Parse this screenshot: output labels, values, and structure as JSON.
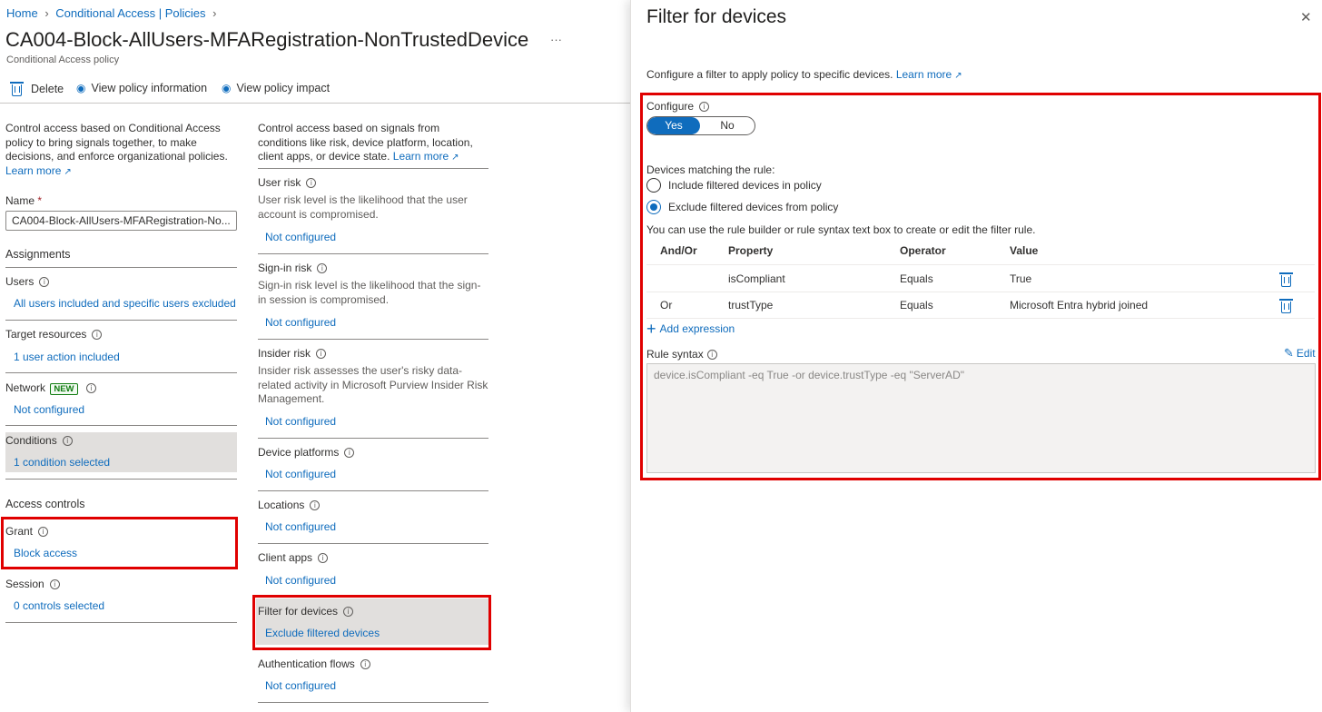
{
  "breadcrumb": {
    "home": "Home",
    "separator": ">",
    "policies": "Conditional Access | Policies"
  },
  "page": {
    "title": "CA004-Block-AllUsers-MFARegistration-NonTrustedDevice",
    "more": "···",
    "subtitle": "Conditional Access policy"
  },
  "toolbar": {
    "delete": "Delete",
    "view_info": "View policy information",
    "view_impact": "View policy impact"
  },
  "left": {
    "intro": "Control access based on Conditional Access policy to bring signals together, to make decisions, and enforce organizational policies.",
    "learn_more": "Learn more",
    "name_label": "Name",
    "required": "*",
    "name_value": "CA004-Block-AllUsers-MFARegistration-No...",
    "assignments": "Assignments",
    "users_label": "Users",
    "users_value": "All users included and specific users excluded",
    "target_label": "Target resources",
    "target_value": "1 user action included",
    "network_label": "Network",
    "network_badge": "NEW",
    "network_value": "Not configured",
    "conditions_label": "Conditions",
    "conditions_value": "1 condition selected",
    "access_controls": "Access controls",
    "grant_label": "Grant",
    "grant_value": "Block access",
    "session_label": "Session",
    "session_value": "0 controls selected"
  },
  "middle": {
    "intro": "Control access based on signals from conditions like risk, device platform, location, client apps, or device state.",
    "learn_more": "Learn more",
    "user_risk": {
      "label": "User risk",
      "desc": "User risk level is the likelihood that the user account is compromised.",
      "value": "Not configured"
    },
    "signin_risk": {
      "label": "Sign-in risk",
      "desc": "Sign-in risk level is the likelihood that the sign-in session is compromised.",
      "value": "Not configured"
    },
    "insider_risk": {
      "label": "Insider risk",
      "desc": "Insider risk assesses the user's risky data-related activity in Microsoft Purview Insider Risk Management.",
      "value": "Not configured"
    },
    "device_platforms": {
      "label": "Device platforms",
      "value": "Not configured"
    },
    "locations": {
      "label": "Locations",
      "value": "Not configured"
    },
    "client_apps": {
      "label": "Client apps",
      "value": "Not configured"
    },
    "filter_devices": {
      "label": "Filter for devices",
      "value": "Exclude filtered devices"
    },
    "auth_flows": {
      "label": "Authentication flows",
      "value": "Not configured"
    }
  },
  "panel": {
    "title": "Filter for devices",
    "close": "✕",
    "description": "Configure a filter to apply policy to specific devices.",
    "learn_more": "Learn more",
    "configure_label": "Configure",
    "toggle_yes": "Yes",
    "toggle_no": "No",
    "matching_label": "Devices matching the rule:",
    "include_option": "Include filtered devices in policy",
    "exclude_option": "Exclude filtered devices from policy",
    "builder_hint": "You can use the rule builder or rule syntax text box to create or edit the filter rule.",
    "table_headers": {
      "andor": "And/Or",
      "property": "Property",
      "operator": "Operator",
      "value": "Value"
    },
    "rows": [
      {
        "andor": "",
        "property": "isCompliant",
        "operator": "Equals",
        "value": "True"
      },
      {
        "andor": "Or",
        "property": "trustType",
        "operator": "Equals",
        "value": "Microsoft Entra hybrid joined"
      }
    ],
    "add_expression": "Add expression",
    "rule_syntax_label": "Rule syntax",
    "edit": "Edit",
    "rule_syntax_value": "device.isCompliant -eq True -or device.trustType -eq \"ServerAD\""
  },
  "colors": {
    "accent": "#0f6cbd",
    "highlight": "#e00000",
    "selected_bg": "#e1dfdd"
  }
}
